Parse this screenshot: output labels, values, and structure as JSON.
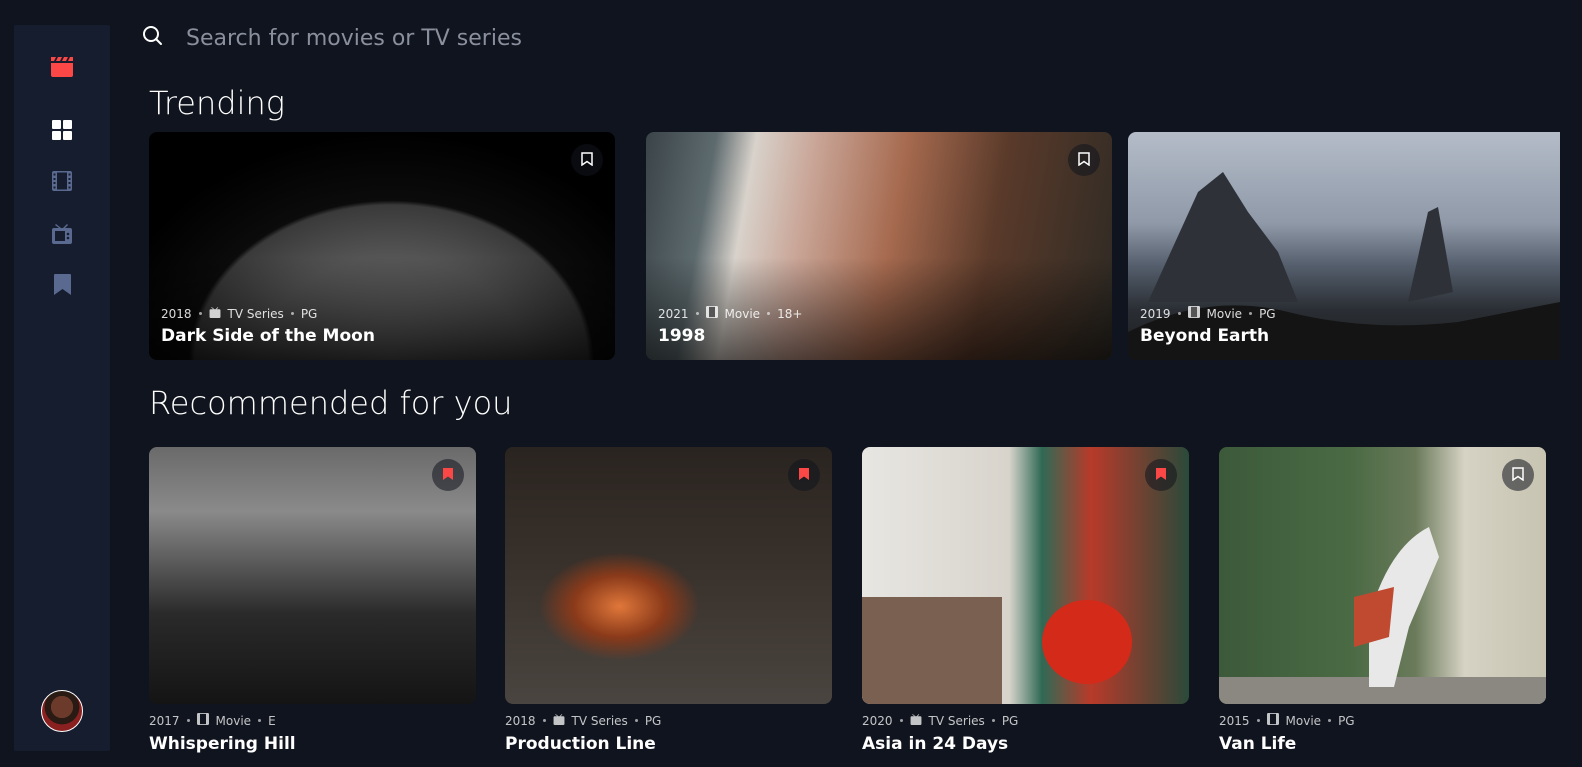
{
  "sidebar": {
    "logo_icon": "clapperboard-icon",
    "accent": "#fc4747",
    "nav": [
      {
        "name": "home",
        "icon": "grid-icon",
        "active": true
      },
      {
        "name": "movies",
        "icon": "film-icon",
        "active": false
      },
      {
        "name": "tv-series",
        "icon": "tv-icon",
        "active": false
      },
      {
        "name": "bookmarks",
        "icon": "bookmark-icon",
        "active": false
      }
    ]
  },
  "search": {
    "placeholder": "Search for movies or TV series"
  },
  "trending": {
    "title": "Trending",
    "items": [
      {
        "year": "2018",
        "category": "TV Series",
        "rating": "PG",
        "title": "Dark Side of the Moon",
        "bookmarked": false
      },
      {
        "year": "2021",
        "category": "Movie",
        "rating": "18+",
        "title": "1998",
        "bookmarked": false
      },
      {
        "year": "2019",
        "category": "Movie",
        "rating": "PG",
        "title": "Beyond Earth",
        "bookmarked": false
      }
    ]
  },
  "recommended": {
    "title": "Recommended for you",
    "items": [
      {
        "year": "2017",
        "category": "Movie",
        "rating": "E",
        "title": "Whispering Hill",
        "bookmarked": true
      },
      {
        "year": "2018",
        "category": "TV Series",
        "rating": "PG",
        "title": "Production Line",
        "bookmarked": true
      },
      {
        "year": "2020",
        "category": "TV Series",
        "rating": "PG",
        "title": "Asia in 24 Days",
        "bookmarked": true
      },
      {
        "year": "2015",
        "category": "Movie",
        "rating": "PG",
        "title": "Van Life",
        "bookmarked": false
      }
    ]
  }
}
